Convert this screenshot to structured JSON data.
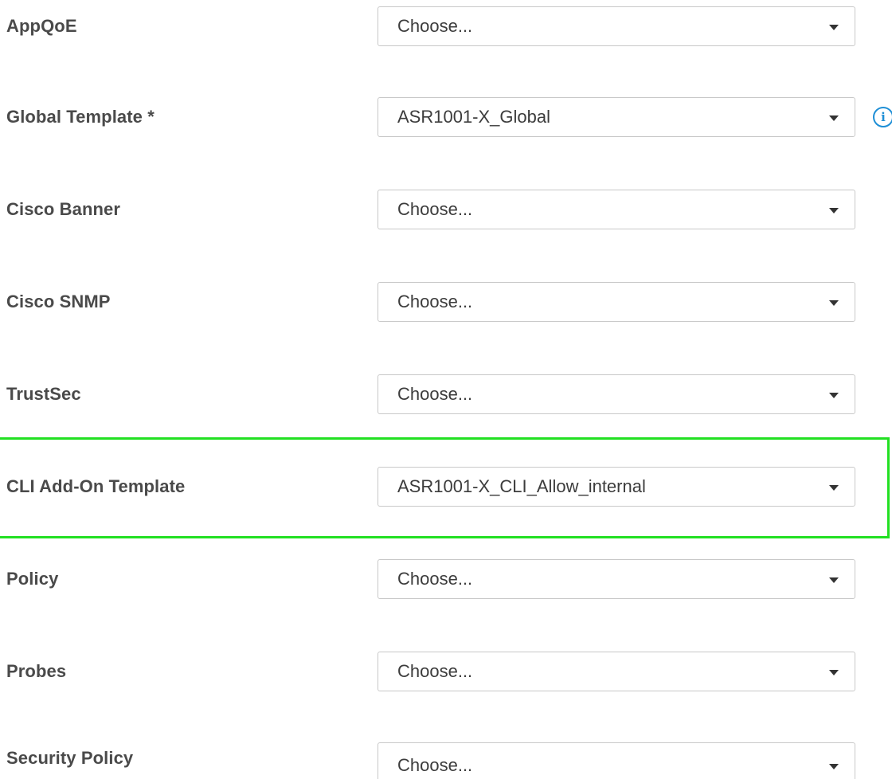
{
  "form": {
    "rows": [
      {
        "label": "AppQoE",
        "value": "Choose..."
      },
      {
        "label": "Global Template *",
        "value": "ASR1001-X_Global"
      },
      {
        "label": "Cisco Banner",
        "value": "Choose..."
      },
      {
        "label": "Cisco SNMP",
        "value": "Choose..."
      },
      {
        "label": "TrustSec",
        "value": "Choose..."
      },
      {
        "label": "CLI Add-On Template",
        "value": "ASR1001-X_CLI_Allow_internal"
      },
      {
        "label": "Policy",
        "value": "Choose..."
      },
      {
        "label": "Probes",
        "value": "Choose..."
      },
      {
        "label": "Security Policy",
        "value": "Choose..."
      }
    ]
  },
  "icons": {
    "info": "i",
    "caret": "chevron-down-icon",
    "info_name": "info-icon"
  },
  "colors": {
    "highlight": "#22e022",
    "info": "#1f8fd6",
    "border": "#c8c8c8",
    "label": "#4a4a4a"
  }
}
